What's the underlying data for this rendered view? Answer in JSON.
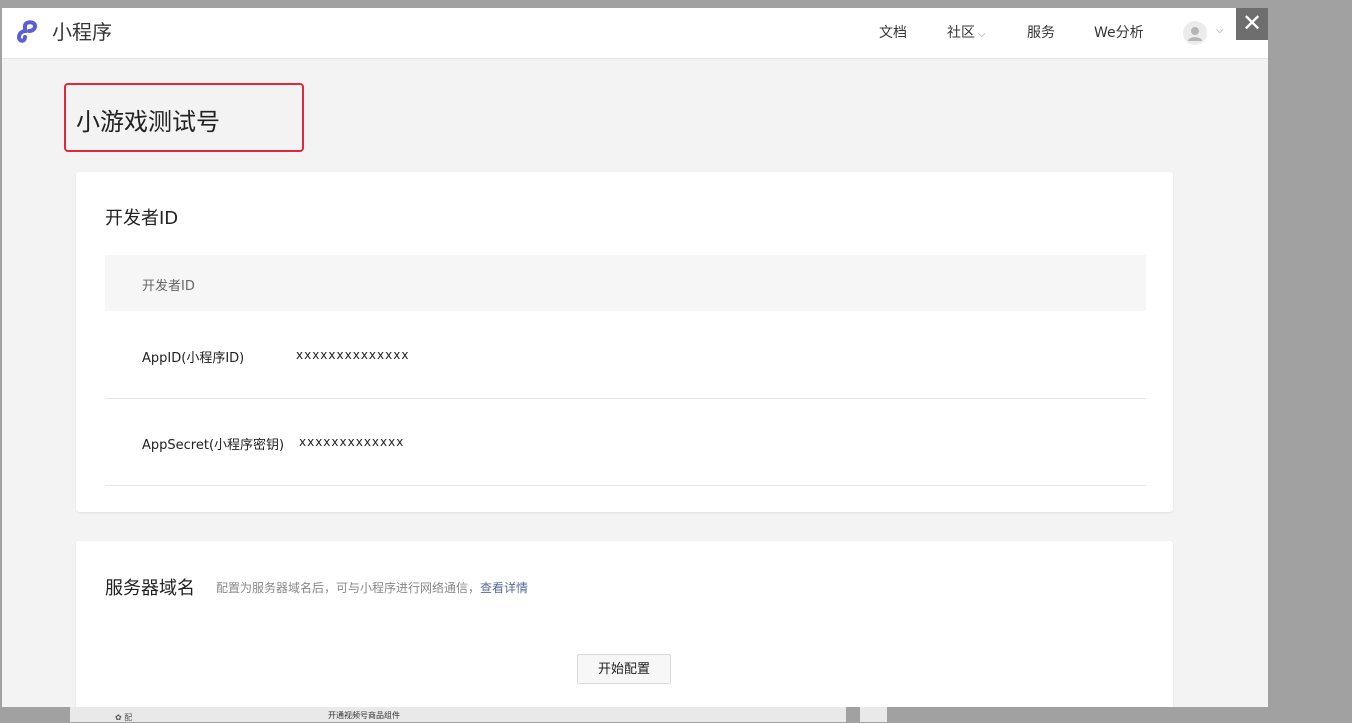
{
  "app": {
    "name": "小程序",
    "brand_color": "#5b5fd6"
  },
  "nav": {
    "docs": "文档",
    "community": "社区",
    "services": "服务",
    "analytics": "We分析",
    "chevron": "⌵"
  },
  "close": "✕",
  "page": {
    "title": "小游戏测试号",
    "highlight_color": "#e0283d"
  },
  "developer": {
    "section_title": "开发者ID",
    "table_header": "开发者ID",
    "rows": [
      {
        "label": "AppID(小程序ID)",
        "value": "xxxxxxxxxxxxxx"
      },
      {
        "label": "AppSecret(小程序密钥)",
        "value": "xxxxxxxxxxxxx"
      }
    ]
  },
  "server": {
    "title": "服务器域名",
    "description": "配置为服务器域名后，可与小程序进行网络通信，",
    "link": "查看详情",
    "link_color": "#576b95",
    "button": "开始配置"
  },
  "background": {
    "text_a": "✿ 配",
    "text_b": "开通视频号商品组件"
  }
}
